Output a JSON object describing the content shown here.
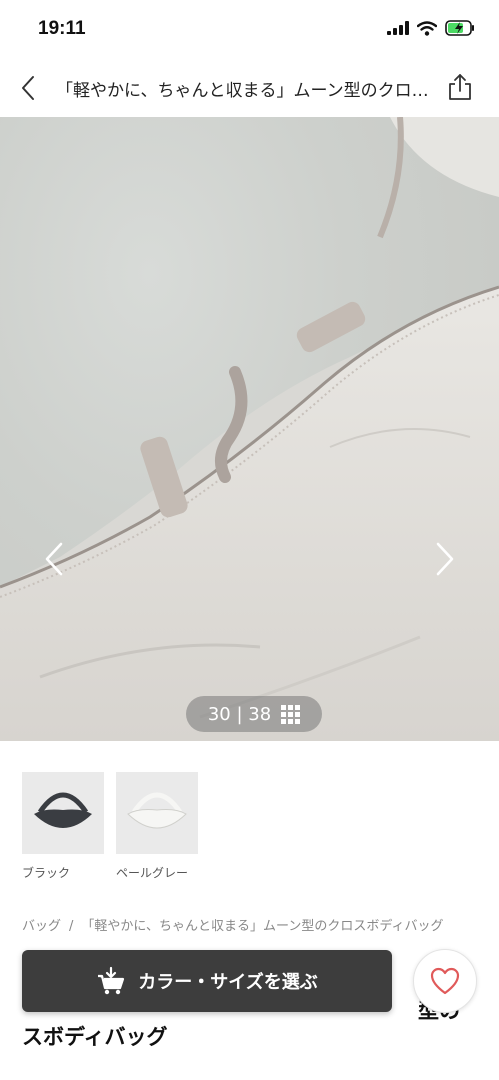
{
  "status_bar": {
    "time": "19:11"
  },
  "nav": {
    "title": "「軽やかに、ちゃんと収まる」ムーン型のクロスボディバッグ"
  },
  "gallery": {
    "counter": "30 | 38"
  },
  "colors": [
    {
      "label": "ブラック",
      "swatch": "#3a3d42"
    },
    {
      "label": "ペールグレー",
      "swatch": "#f1f1ef"
    }
  ],
  "breadcrumb": {
    "category": "バッグ",
    "separator": "/",
    "current": "「軽やかに、ちゃんと収まる」ムーン型のクロスボディバッグ"
  },
  "product": {
    "title_line1": "型の",
    "title_line2": "スボディバッグ"
  },
  "actions": {
    "select_label": "カラー・サイズを選ぶ",
    "favorite_color": "#e05a5a"
  },
  "icons": [
    "signal-icon",
    "wifi-icon",
    "battery-charging-icon",
    "back-icon",
    "share-icon",
    "chevron-left-icon",
    "chevron-right-icon",
    "grid-icon",
    "cart-icon",
    "heart-icon"
  ]
}
